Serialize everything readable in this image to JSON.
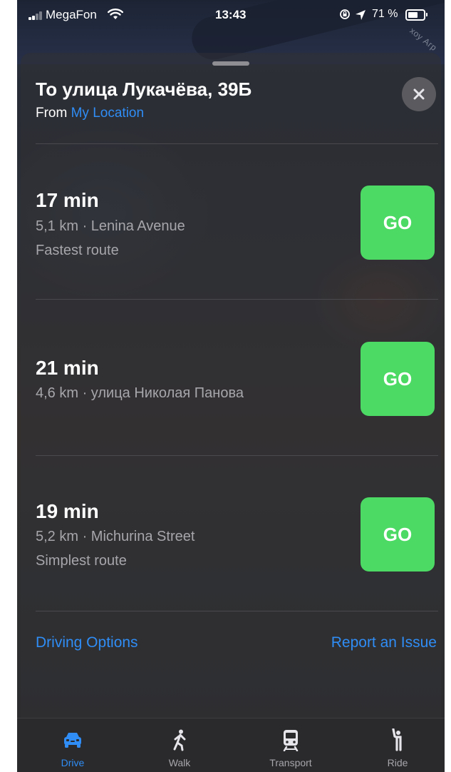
{
  "status_bar": {
    "carrier": "MegaFon",
    "time": "13:43",
    "battery_percent": "71 %",
    "battery_level": 0.71
  },
  "map": {
    "label": "хоу Агр"
  },
  "sheet": {
    "title": "То улица Лукачёва, 39Б",
    "from_prefix": "From",
    "from_location": "My Location"
  },
  "routes": [
    {
      "time": "17 min",
      "details": "5,1 km · Lenina Avenue",
      "note": "Fastest route",
      "go_label": "GO"
    },
    {
      "time": "21 min",
      "details": "4,6 km · улица Николая Панова",
      "note": "",
      "go_label": "GO"
    },
    {
      "time": "19 min",
      "details": "5,2 km · Michurina Street",
      "note": "Simplest route",
      "go_label": "GO"
    }
  ],
  "footer": {
    "driving_options": "Driving Options",
    "report_issue": "Report an Issue"
  },
  "tabs": [
    {
      "label": "Drive",
      "icon": "car-icon",
      "active": true
    },
    {
      "label": "Walk",
      "icon": "walk-icon",
      "active": false
    },
    {
      "label": "Transport",
      "icon": "train-icon",
      "active": false
    },
    {
      "label": "Ride",
      "icon": "person-hail-icon",
      "active": false
    }
  ],
  "colors": {
    "accent": "#2f8df5",
    "go_green": "#4cd964",
    "sheet_bg": "#323234",
    "secondary_text": "#a6a6ab"
  }
}
